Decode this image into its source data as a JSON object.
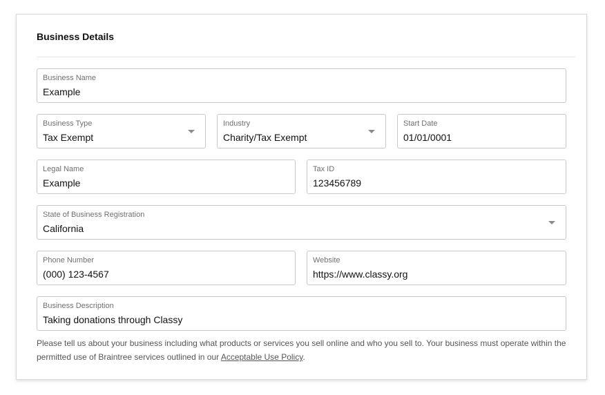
{
  "section": {
    "title": "Business Details"
  },
  "fields": {
    "business_name": {
      "label": "Business Name",
      "value": "Example"
    },
    "business_type": {
      "label": "Business Type",
      "value": "Tax Exempt"
    },
    "industry": {
      "label": "Industry",
      "value": "Charity/Tax Exempt"
    },
    "start_date": {
      "label": "Start Date",
      "value": "01/01/0001"
    },
    "legal_name": {
      "label": "Legal Name",
      "value": "Example"
    },
    "tax_id": {
      "label": "Tax ID",
      "value": "123456789"
    },
    "state_registration": {
      "label": "State of Business Registration",
      "value": "California"
    },
    "phone": {
      "label": "Phone Number",
      "value": "(000) 123-4567"
    },
    "website": {
      "label": "Website",
      "value": "https://www.classy.org"
    },
    "description": {
      "label": "Business Description",
      "value": "Taking donations through Classy"
    }
  },
  "help": {
    "text_before": "Please tell us about your business including what products or services you sell online and who you sell to. Your business must operate within the permitted use of Braintree services outlined in our ",
    "link_text": "Acceptable Use Policy",
    "text_after": "."
  },
  "icons": {
    "dropdown": "chevron-down-icon"
  }
}
